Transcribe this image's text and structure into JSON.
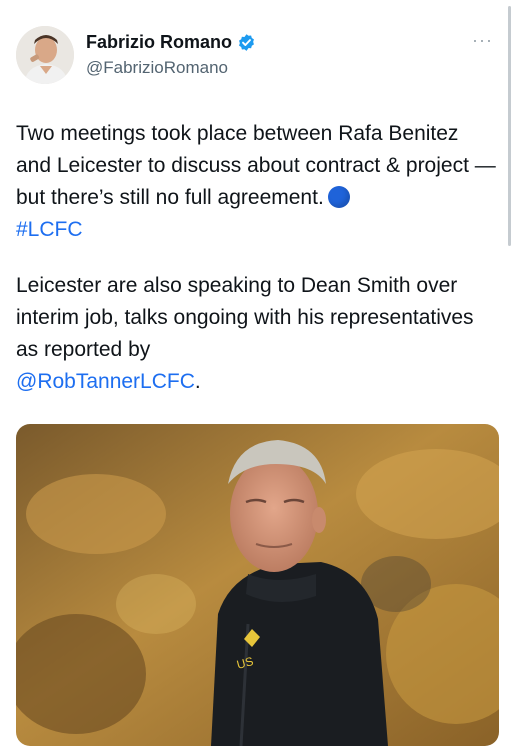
{
  "author": {
    "name": "Fabrizio Romano",
    "handle": "@FabrizioRomano",
    "verified": true,
    "avatar_icon": "profile-photo"
  },
  "menu": {
    "more_label": "···"
  },
  "tweet": {
    "paragraph1": {
      "text": "Two meetings took place between Rafa Benitez and Leicester to discuss about contract & project — but there’s still no full agreement.",
      "emoji": "blue-circle",
      "hashtag": "#LCFC"
    },
    "paragraph2": {
      "text": "Leicester are also speaking to Dean Smith over interim job, talks ongoing with his representatives as reported by",
      "mention": "@RobTannerLCFC",
      "trailing": "."
    }
  },
  "media": {
    "type": "photo",
    "jacket_text": "US",
    "colors": {
      "background": "#b3863a",
      "jacket": "#1a1d21",
      "hair": "#c9c6bd"
    }
  },
  "colors": {
    "link": "#1d6ef0",
    "verified": "#1d9bf0",
    "secondary_text": "#536471"
  }
}
